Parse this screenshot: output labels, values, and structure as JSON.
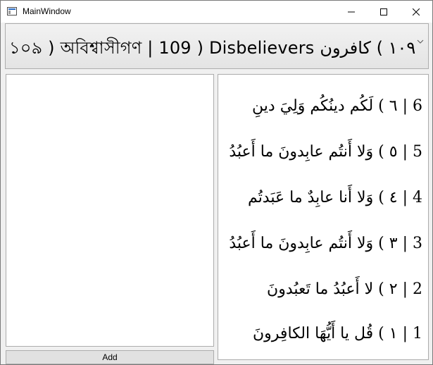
{
  "window": {
    "title": "MainWindow",
    "icons": {
      "app": "window-app-icon",
      "minimize": "minimize-icon",
      "maximize": "maximize-icon",
      "close": "close-icon"
    }
  },
  "surah_selector": {
    "selected_text": "১০৯ ) অবিশ্বাসীগণ  | 109 ) Disbelievers    ١٠٩ ) كافرون",
    "icon": "chevron-down-icon"
  },
  "add_button": {
    "label": "Add"
  },
  "verses": [
    {
      "text": "6 | ٦ ) لَكُم دينُكُم وَلِيَ دينِ"
    },
    {
      "text": "5 | ٥ ) وَلا أَنتُم عابِدونَ ما أَعبُدُ"
    },
    {
      "text": "4 | ٤ ) وَلا أَنا عابِدٌ ما عَبَدتُم"
    },
    {
      "text": "3 | ٣ ) وَلا أَنتُم عابِدونَ ما أَعبُدُ"
    },
    {
      "text": "2 | ٢ ) لا أَعبُدُ ما تَعبُدونَ"
    },
    {
      "text": "1 | ١ ) قُل يا أَيُّهَا الكافِرونَ"
    }
  ]
}
